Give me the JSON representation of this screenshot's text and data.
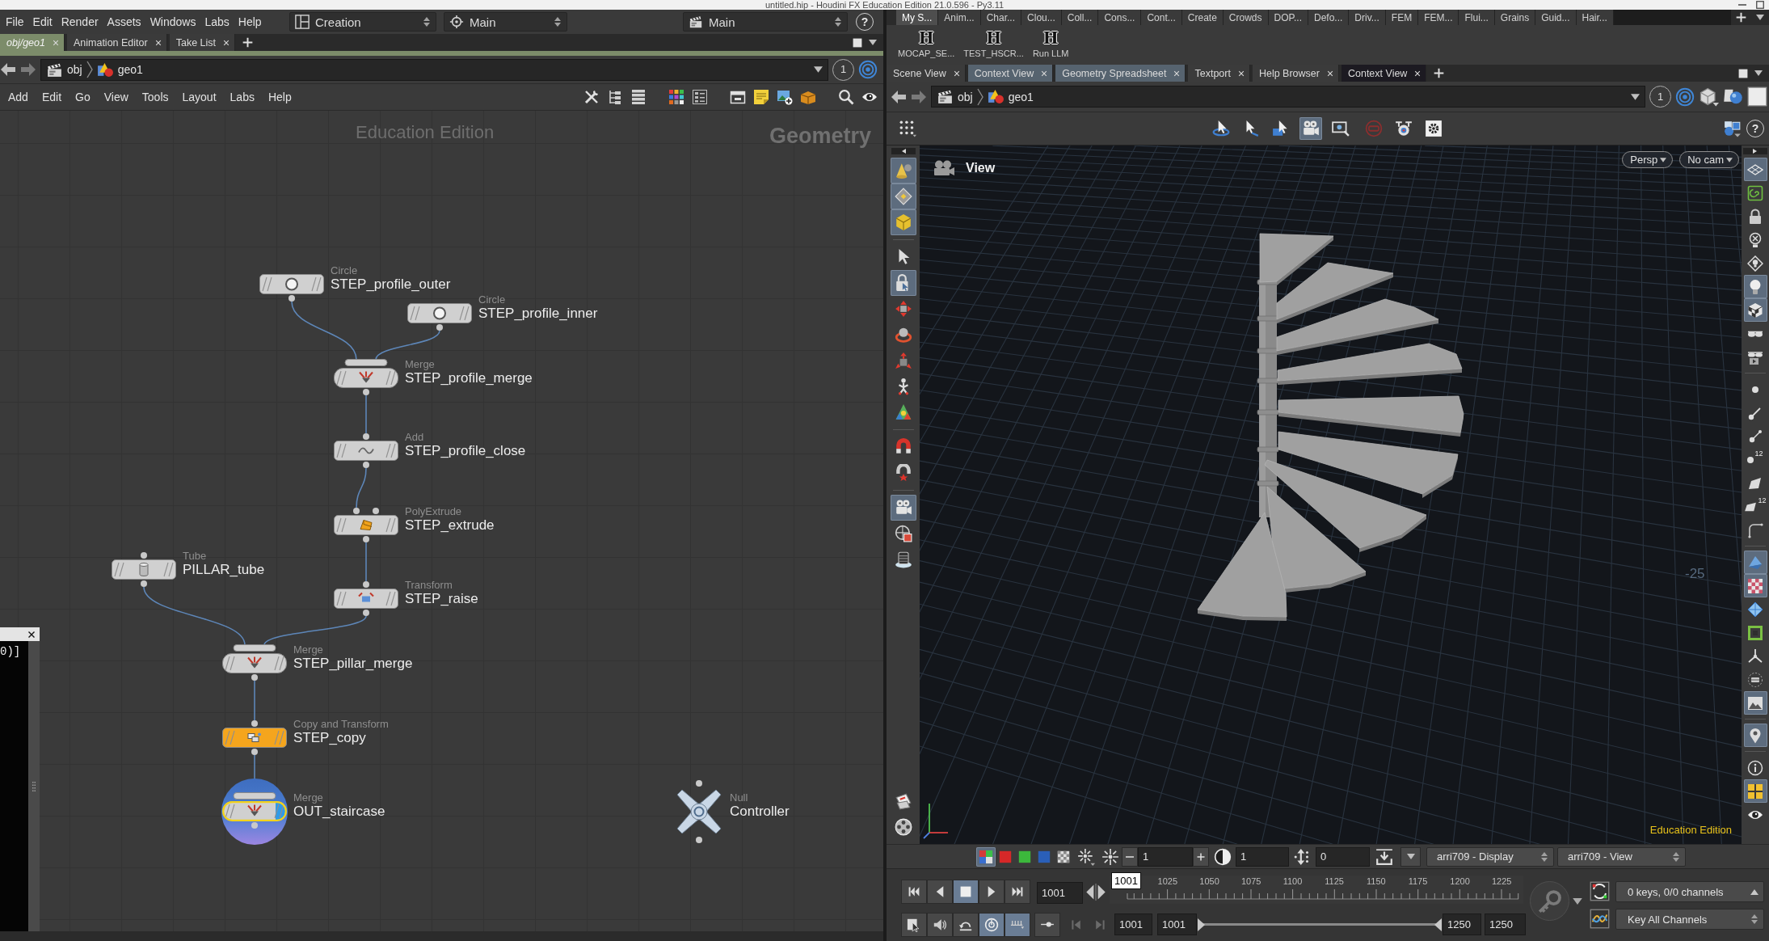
{
  "window": {
    "title": "untitled.hip - Houdini FX Education Edition 21.0.596 - Py3.11"
  },
  "main_menu": [
    "File",
    "Edit",
    "Render",
    "Assets",
    "Windows",
    "Labs",
    "Help"
  ],
  "desktop_menu": "Creation",
  "context_menu": "Main",
  "shelf_set_menu": "Main",
  "help_button": "?",
  "shelf": {
    "tabs": [
      {
        "label": "My S...",
        "selected": true
      },
      {
        "label": "Anim...",
        "selected": false
      },
      {
        "label": "Char...",
        "selected": false
      },
      {
        "label": "Clou...",
        "selected": false
      },
      {
        "label": "Coll...",
        "selected": false
      },
      {
        "label": "Cons...",
        "selected": false
      },
      {
        "label": "Cont...",
        "selected": false
      },
      {
        "label": "Create",
        "selected": false
      },
      {
        "label": "Crowds",
        "selected": false
      },
      {
        "label": "DOP...",
        "selected": false
      },
      {
        "label": "Defo...",
        "selected": false
      },
      {
        "label": "Driv...",
        "selected": false
      },
      {
        "label": "FEM",
        "selected": false
      },
      {
        "label": "FEM...",
        "selected": false
      },
      {
        "label": "Flui...",
        "selected": false
      },
      {
        "label": "Grains",
        "selected": false
      },
      {
        "label": "Guid...",
        "selected": false
      },
      {
        "label": "Hair...",
        "selected": false
      }
    ],
    "tools": [
      {
        "glyph": "H",
        "label": "MOCAP_SE..."
      },
      {
        "glyph": "H",
        "label": "TEST_HSCR..."
      },
      {
        "glyph": "H",
        "label": "Run LLM"
      }
    ]
  },
  "network_pane": {
    "tabs": [
      {
        "label": "obj/geo1",
        "selected": true
      },
      {
        "label": "Animation Editor",
        "selected": false
      },
      {
        "label": "Take List",
        "selected": false
      }
    ],
    "path": [
      "obj",
      "geo1"
    ],
    "link_group": "1",
    "menu": [
      "Add",
      "Edit",
      "Go",
      "View",
      "Tools",
      "Layout",
      "Labs",
      "Help"
    ],
    "edition_label": "Education Edition",
    "context_label": "Geometry",
    "nodes": [
      {
        "type": "Circle",
        "name": "STEP_profile_outer",
        "kind": "circle",
        "color": "#d0d0d0",
        "selected": false,
        "display": false
      },
      {
        "type": "Circle",
        "name": "STEP_profile_inner",
        "kind": "circle",
        "color": "#d0d0d0",
        "selected": false,
        "display": false
      },
      {
        "type": "Merge",
        "name": "STEP_profile_merge",
        "kind": "merge",
        "color": "#d0d0d0",
        "selected": false,
        "display": false
      },
      {
        "type": "Add",
        "name": "STEP_profile_close",
        "kind": "add",
        "color": "#d0d0d0",
        "selected": false,
        "display": false
      },
      {
        "type": "PolyExtrude",
        "name": "STEP_extrude",
        "kind": "polyextrude",
        "color": "#d0d0d0",
        "selected": false,
        "display": false
      },
      {
        "type": "Transform",
        "name": "STEP_raise",
        "kind": "transform",
        "color": "#d0d0d0",
        "selected": false,
        "display": false
      },
      {
        "type": "Tube",
        "name": "PILLAR_tube",
        "kind": "tube",
        "color": "#d0d0d0",
        "selected": false,
        "display": false
      },
      {
        "type": "Merge",
        "name": "STEP_pillar_merge",
        "kind": "merge",
        "color": "#d0d0d0",
        "selected": false,
        "display": false
      },
      {
        "type": "Copy and Transform",
        "name": "STEP_copy",
        "kind": "copy",
        "color": "#f5a51d",
        "selected": false,
        "display": false
      },
      {
        "type": "Merge",
        "name": "OUT_staircase",
        "kind": "merge",
        "color": "#d0d0d0",
        "selected": true,
        "display": true
      },
      {
        "type": "Null",
        "name": "Controller",
        "kind": "null",
        "color": "#c9d7e6",
        "selected": false,
        "display": false
      }
    ]
  },
  "floating_panel": {
    "text": "0)]"
  },
  "viewer_pane": {
    "tabs": [
      {
        "label": "Scene View",
        "selected": false,
        "highlighted": false
      },
      {
        "label": "Context View",
        "selected": false,
        "highlighted": true
      },
      {
        "label": "Geometry Spreadsheet",
        "selected": false,
        "highlighted": true
      },
      {
        "label": "Textport",
        "selected": false,
        "highlighted": false
      },
      {
        "label": "Help Browser",
        "selected": false,
        "highlighted": false
      },
      {
        "label": "Context View",
        "selected": true,
        "highlighted": false
      }
    ],
    "path": [
      "obj",
      "geo1"
    ],
    "link_group": "1",
    "toolbar": [
      {
        "on": false
      },
      {
        "on": false
      },
      {
        "on": false
      },
      {
        "on": false
      },
      {
        "on": true
      },
      {
        "on": false
      },
      {
        "on": false
      },
      {
        "on": false
      },
      {
        "on": false
      },
      {
        "on": false
      }
    ],
    "help_button": "?",
    "view_label": "View",
    "camera_menus": [
      "Persp",
      "No cam"
    ],
    "grid_label": "-25",
    "edition_label": "Education Edition",
    "left_tools": [
      {
        "on": true
      },
      {
        "on": true
      },
      {
        "on": true
      },
      {
        "on": false
      },
      {
        "on": true
      },
      {
        "on": false
      },
      {
        "on": false
      },
      {
        "on": false
      },
      {
        "on": false
      },
      {
        "on": false
      },
      {
        "on": false
      },
      {
        "on": false
      },
      {
        "on": true
      },
      {
        "on": false
      },
      {
        "on": false
      },
      {
        "on": false
      },
      {
        "on": false
      }
    ],
    "right_tools": [
      {
        "on": true
      },
      {
        "on": false
      },
      {
        "on": false
      },
      {
        "on": false
      },
      {
        "on": false
      },
      {
        "on": true
      },
      {
        "on": true
      },
      {
        "on": false
      },
      {
        "on": false
      },
      {
        "on": false
      },
      {
        "on": false
      },
      {
        "on": false
      },
      {
        "on": false
      },
      {
        "on": false
      },
      {
        "on": false
      },
      {
        "on": false
      },
      {
        "on": true
      },
      {
        "on": true
      },
      {
        "on": false
      },
      {
        "on": false
      },
      {
        "on": false
      },
      {
        "on": false
      },
      {
        "on": true
      },
      {
        "on": true
      },
      {
        "on": false
      },
      {
        "on": true
      },
      {
        "on": false
      }
    ],
    "right_tool_labels": [
      "12",
      "12"
    ]
  },
  "display_bar": {
    "toggles": [
      {
        "on": true
      },
      {
        "on": false
      },
      {
        "on": false
      },
      {
        "on": false
      },
      {
        "on": false
      }
    ],
    "fields": [
      "1",
      "1",
      "0"
    ],
    "display_menu": "arri709 - Display",
    "view_menu": "arri709 - View"
  },
  "playbar": {
    "transport": [
      {
        "on": false
      },
      {
        "on": false
      },
      {
        "on": true
      },
      {
        "on": false
      },
      {
        "on": false
      }
    ],
    "frame": "1001",
    "current_frame": "1001",
    "ticks": [
      "1025",
      "1050",
      "1075",
      "1100",
      "1125",
      "1150",
      "1175",
      "1200",
      "1225"
    ],
    "options": [
      {
        "on": false
      },
      {
        "on": false
      },
      {
        "on": false
      },
      {
        "on": true
      },
      {
        "on": true
      },
      {
        "on": false
      }
    ],
    "range": [
      "1001",
      "1001",
      "1250",
      "1250"
    ],
    "range_slider": {
      "level": 1
    },
    "keys_status": "0 keys, 0/0 channels",
    "key_menu": "Key All Channels"
  }
}
